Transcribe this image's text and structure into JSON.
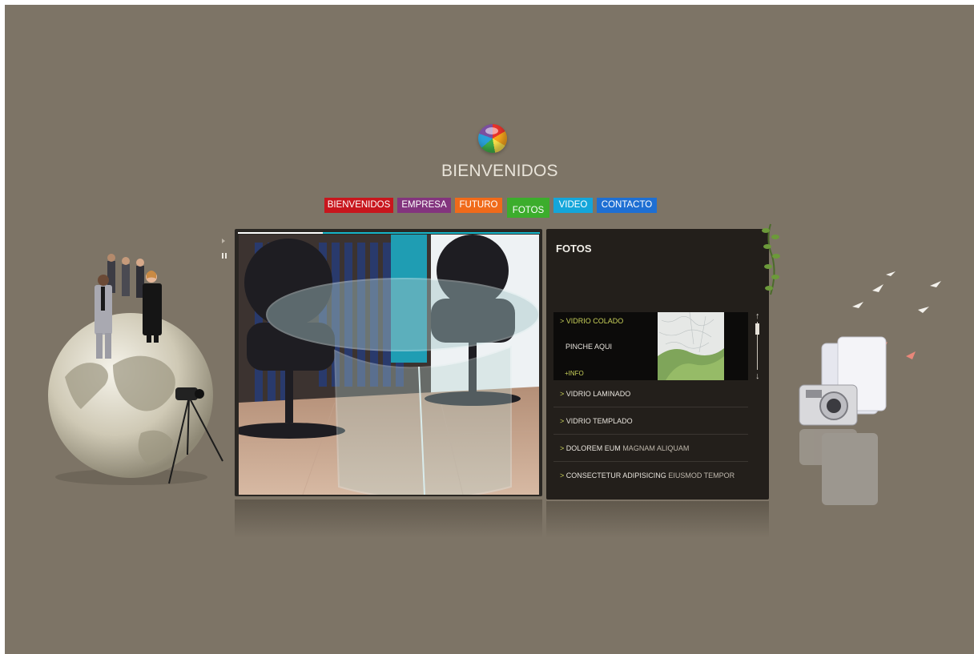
{
  "header": {
    "title": "BIENVENIDOS"
  },
  "nav": {
    "items": [
      {
        "label": "BIENVENIDOS",
        "color": "#c8161d"
      },
      {
        "label": "EMPRESA",
        "color": "#83347e"
      },
      {
        "label": "FUTURO",
        "color": "#f06a1a"
      },
      {
        "label": "FOTOS",
        "color": "#3cad2c",
        "active": true
      },
      {
        "label": "VIDEO",
        "color": "#14a6da"
      },
      {
        "label": "CONTACTO",
        "color": "#1e6fd3"
      }
    ]
  },
  "slideshow": {
    "progress": 0.28,
    "controls": [
      "play-icon",
      "pause-icon"
    ]
  },
  "panel": {
    "title": "FOTOS",
    "active": {
      "label": "VIDRIO COLADO",
      "cta": "PINCHE AQUI",
      "info": "+INFO"
    },
    "items": [
      {
        "bold": "VIDRIO LAMINADO",
        "light": ""
      },
      {
        "bold": "VIDRIO TEMPLADO",
        "light": ""
      },
      {
        "bold": "DOLOREM EUM",
        "light": "MAGNAM ALIQUAM"
      },
      {
        "bold": "CONSECTETUR ADIPISICING",
        "light": "EIUSMOD TEMPOR"
      }
    ],
    "arrow": ">"
  },
  "colors": {
    "background": "#7d7466",
    "panel": "#231f1b",
    "accent": "#c9d15a"
  }
}
